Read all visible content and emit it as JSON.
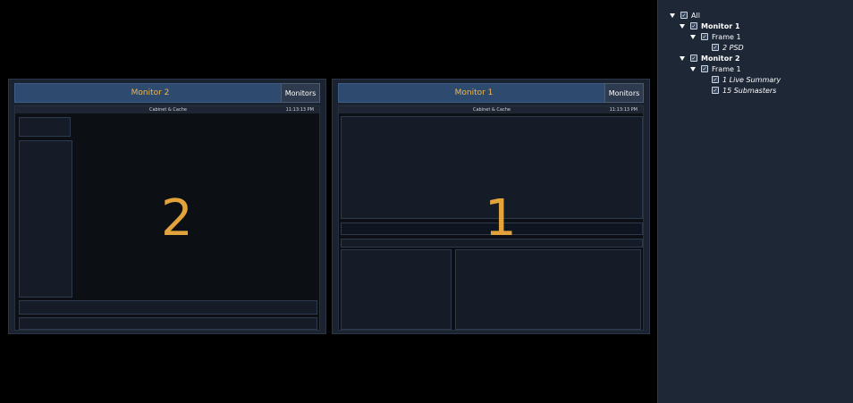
{
  "monitors": [
    {
      "id": "monitor-2",
      "header": "Monitor 2",
      "button": "Monitors",
      "screen_label": "2",
      "screen_title": "Cabinet & Cache",
      "time": "11:13:13 PM"
    },
    {
      "id": "monitor-1",
      "header": "Monitor 1",
      "button": "Monitors",
      "screen_label": "1",
      "screen_title": "Cabinet & Cache",
      "time": "11:13:13 PM"
    }
  ],
  "tree": {
    "items": [
      {
        "label": "All",
        "level": 0,
        "expanded": true,
        "checked": true,
        "style": "normal"
      },
      {
        "label": "Monitor 1",
        "level": 1,
        "expanded": true,
        "checked": true,
        "style": "bold"
      },
      {
        "label": "Frame 1",
        "level": 2,
        "expanded": true,
        "checked": true,
        "style": "normal"
      },
      {
        "label": "2 PSD",
        "level": 3,
        "expanded": false,
        "checked": true,
        "style": "italic"
      },
      {
        "label": "Monitor 2",
        "level": 1,
        "expanded": true,
        "checked": true,
        "style": "bold"
      },
      {
        "label": "Frame 1",
        "level": 2,
        "expanded": true,
        "checked": true,
        "style": "normal"
      },
      {
        "label": "1 Live Summary",
        "level": 3,
        "expanded": false,
        "checked": true,
        "style": "italic"
      },
      {
        "label": "15 Submasters",
        "level": 3,
        "expanded": false,
        "checked": true,
        "style": "italic"
      }
    ]
  },
  "colors": {
    "accent": "#e2a33c",
    "header_bg": "#2e4a6e",
    "tree_bg": "#1d2736"
  }
}
